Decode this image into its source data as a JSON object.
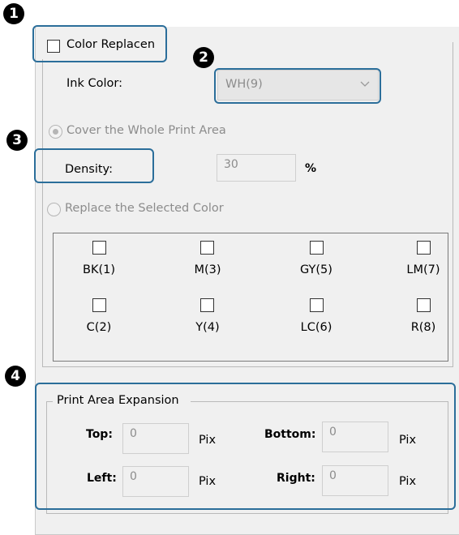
{
  "color_replacement": {
    "label": "Color Replacen",
    "checked": false
  },
  "ink_color": {
    "label": "Ink Color:",
    "value": "WH(9)"
  },
  "cover_whole": {
    "label": "Cover the Whole Print Area",
    "selected": true
  },
  "density": {
    "label": "Density:",
    "value": "30",
    "unit": "%"
  },
  "replace_selected": {
    "label": "Replace the Selected Color",
    "selected": false
  },
  "colors": {
    "row1": [
      "BK(1)",
      "M(3)",
      "GY(5)",
      "LM(7)"
    ],
    "row2": [
      "C(2)",
      "Y(4)",
      "LC(6)",
      "R(8)"
    ]
  },
  "expansion": {
    "title": "Print Area Expansion",
    "top": {
      "label": "Top:",
      "value": "0",
      "unit": "Pix"
    },
    "bottom": {
      "label": "Bottom:",
      "value": "0",
      "unit": "Pix"
    },
    "left": {
      "label": "Left:",
      "value": "0",
      "unit": "Pix"
    },
    "right": {
      "label": "Right:",
      "value": "0",
      "unit": "Pix"
    }
  },
  "badges": [
    "1",
    "2",
    "3",
    "4"
  ],
  "accent": "#2b6e9a"
}
